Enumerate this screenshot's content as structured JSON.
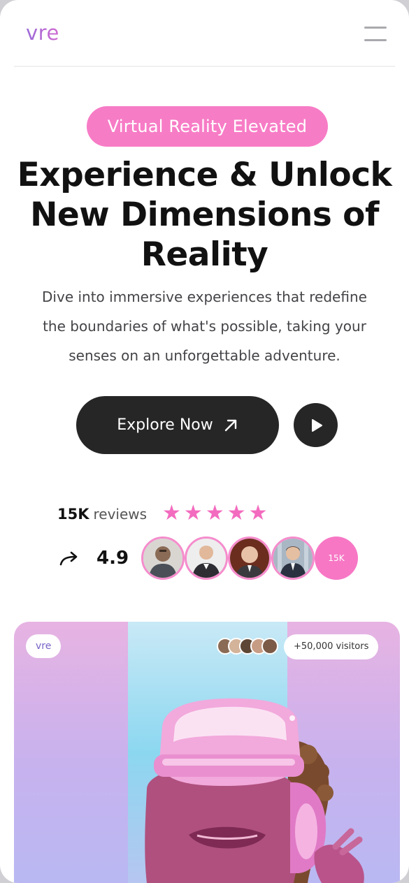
{
  "header": {
    "logo": "vre",
    "menu_icon": "hamburger-menu-icon"
  },
  "hero": {
    "badge": "Virtual Reality Elevated",
    "title_lines": [
      "Experience & Unlock",
      "New Dimensions of",
      "Reality"
    ],
    "subtitle_lines": [
      "Dive into immersive experiences that redefine",
      "the boundaries of what's possible, taking your",
      "senses on an unforgettable adventure."
    ],
    "cta_label": "Explore Now",
    "cta_icon": "arrow-up-right-icon",
    "play_icon": "play-icon"
  },
  "reviews": {
    "count": "15K",
    "label": "reviews",
    "stars": 5,
    "rating": "4.9",
    "rating_icon": "share-arrow-icon",
    "more_count": "15K"
  },
  "banner": {
    "tag": "vre",
    "visitors": "+50,000 visitors"
  },
  "colors": {
    "accent_pink": "#f77cc6",
    "dark": "#262626",
    "logo_purple": "#b06ad9"
  }
}
